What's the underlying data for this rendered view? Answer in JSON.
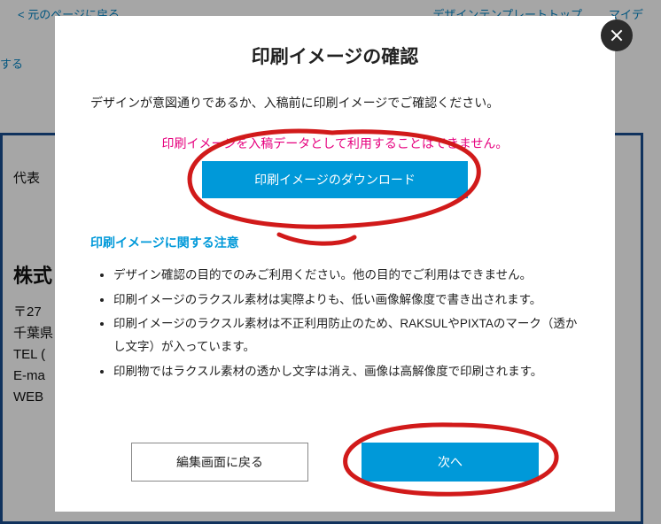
{
  "bg": {
    "back_link": "< 元のページに戻る",
    "nav1": "デザインテンプレートトップ",
    "nav2": "マイデ",
    "sub_action": "する",
    "rep": "代表",
    "company": "株式",
    "zip": "〒27",
    "addr": "千葉県",
    "tel": "TEL (",
    "email": "E-ma",
    "web": "WEB"
  },
  "modal": {
    "title": "印刷イメージの確認",
    "desc": "デザインが意図通りであるか、入稿前に印刷イメージでご確認ください。",
    "warning": "印刷イメージを入稿データとして利用することはできません。",
    "download_label": "印刷イメージのダウンロード",
    "notice_title": "印刷イメージに関する注意",
    "notices": [
      "デザイン確認の目的でのみご利用ください。他の目的でご利用はできません。",
      "印刷イメージのラクスル素材は実際よりも、低い画像解像度で書き出されます。",
      "印刷イメージのラクスル素材は不正利用防止のため、RAKSULやPIXTAのマーク（透かし文字）が入っています。",
      "印刷物ではラクスル素材の透かし文字は消え、画像は高解像度で印刷されます。"
    ],
    "back_label": "編集画面に戻る",
    "next_label": "次へ"
  },
  "colors": {
    "brand_blue": "#0099d9",
    "magenta": "#e6007e",
    "annotation_red": "#d11a1a"
  }
}
